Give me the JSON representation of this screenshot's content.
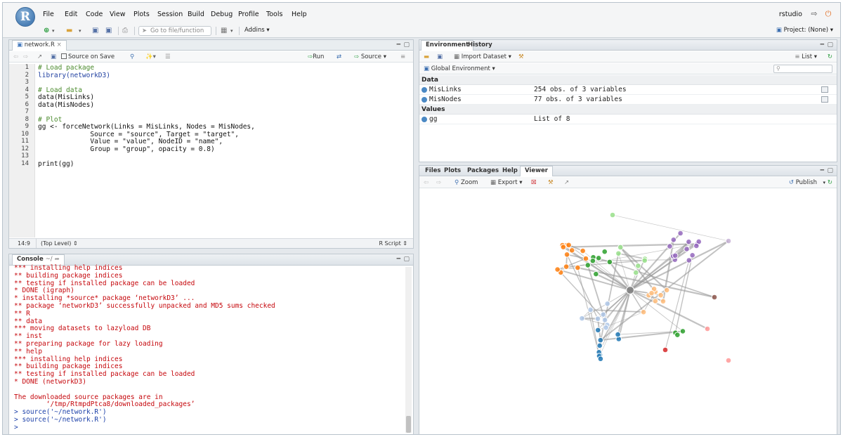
{
  "menubar": {
    "logo": "R",
    "items": [
      "File",
      "Edit",
      "Code",
      "View",
      "Plots",
      "Session",
      "Build",
      "Debug",
      "Profile",
      "Tools",
      "Help"
    ],
    "user": "rstudio"
  },
  "toolbar": {
    "goto_placeholder": "Go to file/function",
    "addins": "Addins",
    "project": "Project: (None)"
  },
  "editor": {
    "tab": "network.R",
    "source_on_save": "Source on Save",
    "run": "Run",
    "source": "Source",
    "status_pos": "14:9",
    "status_scope": "(Top Level)",
    "status_type": "R Script",
    "lines": [
      "1",
      "2",
      "3",
      "4",
      "5",
      "6",
      "7",
      "8",
      "9",
      "10",
      "11",
      "12",
      "13",
      "14"
    ]
  },
  "code": {
    "l1": "# Load package",
    "l2": "library(networkD3)",
    "l4": "# Load data",
    "l5": "data(MisLinks)",
    "l6": "data(MisNodes)",
    "l8": "# Plot",
    "l9": "gg <- forceNetwork(Links = MisLinks, Nodes = MisNodes,",
    "l10": "             Source = \"source\", Target = \"target\",",
    "l11": "             Value = \"value\", NodeID = \"name\",",
    "l12": "             Group = \"group\", opacity = 0.8)",
    "l14": "print(gg)"
  },
  "console": {
    "title": "Console",
    "path": "~/",
    "lines": [
      "*** installing help indices",
      "** building package indices",
      "** testing if installed package can be loaded",
      "* DONE (igraph)",
      "* installing *source* package ‘networkD3’ ...",
      "** package ‘networkD3’ successfully unpacked and MD5 sums checked",
      "** R",
      "** data",
      "*** moving datasets to lazyload DB",
      "** inst",
      "** preparing package for lazy loading",
      "** help",
      "*** installing help indices",
      "** building package indices",
      "** testing if installed package can be loaded",
      "* DONE (networkD3)",
      "",
      "The downloaded source packages are in",
      "        ‘/tmp/RtmpdPtca8/downloaded_packages’"
    ],
    "cmd1": "> source('~/network.R')",
    "cmd2": "> source('~/network.R')",
    "cmd3": ">"
  },
  "environment": {
    "tabs": [
      "Environment",
      "History"
    ],
    "import": "Import Dataset",
    "list_mode": "List",
    "scope": "Global Environment",
    "data_header": "Data",
    "values_header": "Values",
    "data": [
      {
        "name": "MisLinks",
        "value": "254 obs. of 3 variables"
      },
      {
        "name": "MisNodes",
        "value": "77 obs. of 3 variables"
      }
    ],
    "values": [
      {
        "name": "gg",
        "value": "List of 8"
      }
    ]
  },
  "viewer": {
    "tabs": [
      "Files",
      "Plots",
      "Packages",
      "Help",
      "Viewer"
    ],
    "zoom": "Zoom",
    "export": "Export",
    "publish": "Publish"
  },
  "network": {
    "colors": [
      "#ff7f0e",
      "#1f77b4",
      "#2ca02c",
      "#9467bd",
      "#aec7e8",
      "#8c564b",
      "#ffbb78",
      "#d62728",
      "#ff9896",
      "#98df8a",
      "#c5b0d5",
      "#7f7f7f"
    ]
  }
}
